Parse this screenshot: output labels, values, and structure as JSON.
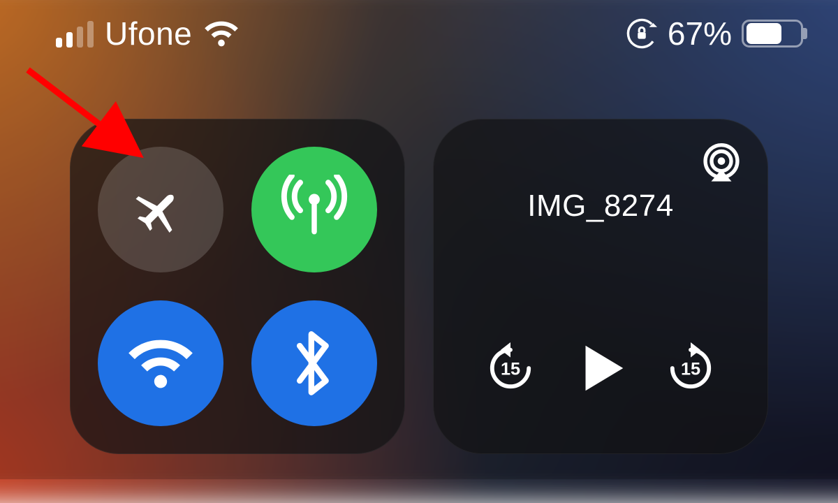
{
  "status": {
    "signal_bars_active": 2,
    "signal_bars_total": 4,
    "carrier": "Ufone",
    "wifi_connected": true,
    "orientation_locked": true,
    "battery_percent_label": "67%",
    "battery_percent_value": 67
  },
  "connectivity": {
    "airplane_mode": {
      "on": false
    },
    "cellular_data": {
      "on": true,
      "color": "#34c759"
    },
    "wifi": {
      "on": true,
      "color": "#1f71e5"
    },
    "bluetooth": {
      "on": true,
      "color": "#1f71e5"
    }
  },
  "media": {
    "title": "IMG_8274",
    "skip_seconds_label": "15",
    "playing": false
  },
  "annotation": {
    "arrow_color": "#ff0000",
    "target": "airplane-mode-toggle"
  }
}
